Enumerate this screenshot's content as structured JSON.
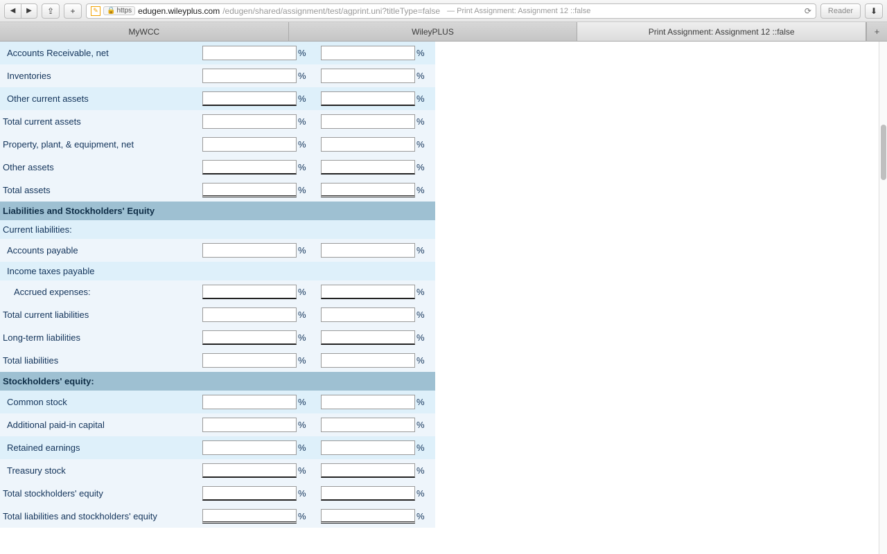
{
  "browser": {
    "https_label": "https",
    "domain": "edugen.wileyplus.com",
    "path": "/edugen/shared/assignment/test/agprint.uni?titleType=false",
    "title_suffix": "— Print Assignment: Assignment 12 ::false",
    "reader_label": "Reader"
  },
  "tabs": {
    "t0": "MyWCC",
    "t1": "WileyPLUS",
    "t2": "Print Assignment: Assignment 12 ::false"
  },
  "pct": "%",
  "rows": {
    "r0": "Accounts Receivable, net",
    "r1": "Inventories",
    "r2": "Other current assets",
    "r3": "Total current assets",
    "r4": "Property, plant, & equipment, net",
    "r5": "Other assets",
    "r6": "Total assets",
    "sec1": "Liabilities and Stockholders' Equity",
    "sub1": "Current liabilities:",
    "r7": "Accounts payable",
    "r8": "Income taxes payable",
    "r9": "Accrued expenses:",
    "r10": "Total current liabilities",
    "r11": "Long-term liabilities",
    "r12": "Total liabilities",
    "sec2": "Stockholders' equity:",
    "r13": "Common stock",
    "r14": "Additional paid-in capital",
    "r15": "Retained earnings",
    "r16": "Treasury stock",
    "r17": "Total stockholders' equity",
    "r18": "Total liabilities and stockholders' equity"
  }
}
